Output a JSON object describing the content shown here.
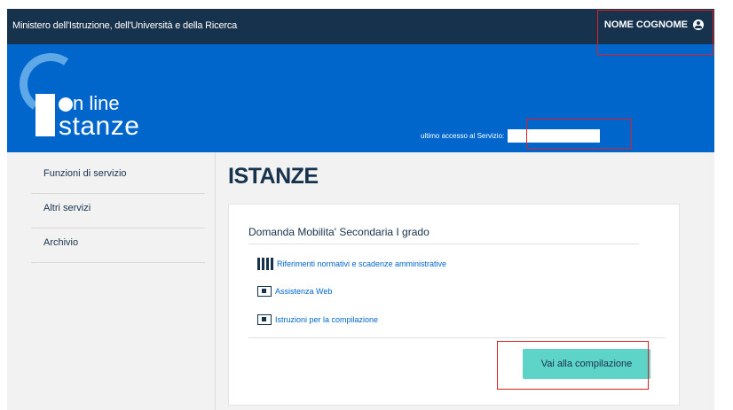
{
  "topbar": {
    "ministry": "Ministero dell'Istruzione, dell'Università e della Ricerca",
    "user_name": "NOME COGNOME",
    "user_icon": "user-circle-icon"
  },
  "header": {
    "logo_line1": "n line",
    "logo_line2": "stanze",
    "last_access_label": "ultimo accesso al Servizio:",
    "last_access_value": ""
  },
  "sidebar": {
    "items": [
      {
        "label": "Funzioni di servizio"
      },
      {
        "label": "Altri servizi"
      },
      {
        "label": "Archivio"
      }
    ]
  },
  "main": {
    "title": "ISTANZE",
    "card": {
      "title": "Domanda Mobilita' Secondaria I grado",
      "links": [
        {
          "label": "Riferimenti normativi e scadenze amministrative",
          "icon": "documents-icon"
        },
        {
          "label": "Assistenza Web",
          "icon": "support-screen-icon"
        },
        {
          "label": "Istruzioni per la compilazione",
          "icon": "instructions-screen-icon"
        }
      ],
      "cta_label": "Vai alla compilazione"
    }
  },
  "colors": {
    "topbar": "#17324d",
    "header": "#0066cc",
    "cta": "#5ed3c8",
    "highlight": "#e02020"
  }
}
